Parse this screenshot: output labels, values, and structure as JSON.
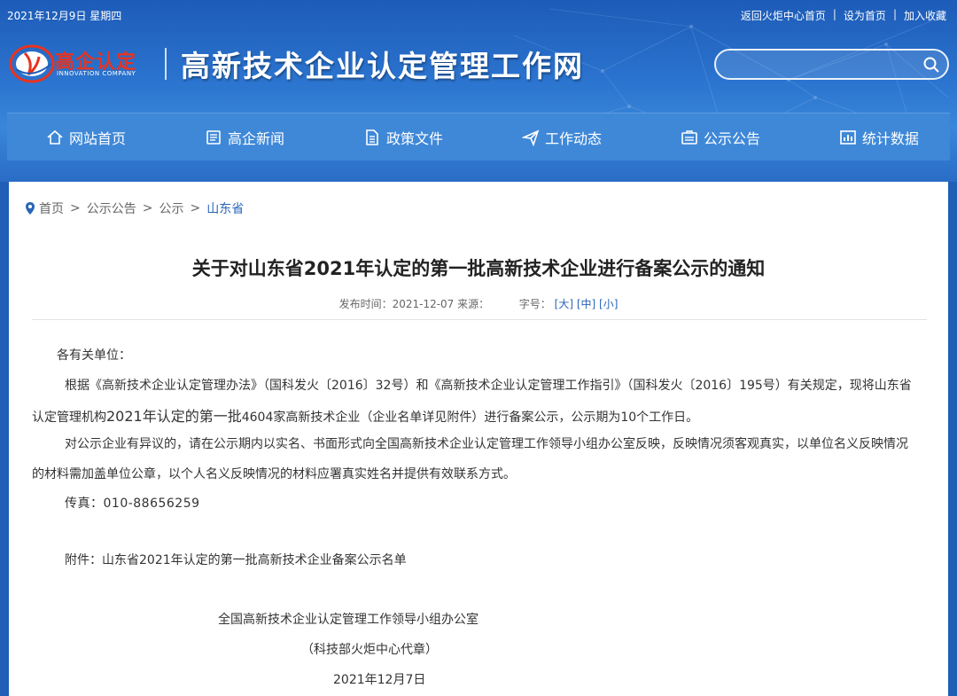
{
  "topbar": {
    "date": "2021年12月9日 星期四",
    "links": [
      "返回火炬中心首页",
      "设为首页",
      "加入收藏"
    ]
  },
  "logo": {
    "name": "高企认定",
    "sub": "INNOVATION COMPANY"
  },
  "site_title": "高新技术企业认定管理工作网",
  "search": {
    "value": "",
    "placeholder": ""
  },
  "nav": [
    {
      "label": "网站首页",
      "icon": "home-icon"
    },
    {
      "label": "高企新闻",
      "icon": "news-icon"
    },
    {
      "label": "政策文件",
      "icon": "document-icon"
    },
    {
      "label": "工作动态",
      "icon": "paper-plane-icon"
    },
    {
      "label": "公示公告",
      "icon": "notice-icon"
    },
    {
      "label": "统计数据",
      "icon": "chart-icon"
    }
  ],
  "breadcrumb": [
    "首页",
    "公示公告",
    "公示",
    "山东省"
  ],
  "article": {
    "title": "关于对山东省2021年认定的第一批高新技术企业进行备案公示的通知",
    "meta_time": "发布时间：2021-12-07 来源：",
    "font_label": "字号：",
    "font_sizes": [
      "[大]",
      "[中]",
      "[小]"
    ],
    "p1": "各有关单位：",
    "p2": "根据《高新技术企业认定管理办法》（国科发火〔2016〕32号）和《高新技术企业认定管理工作指引》（国科发火〔2016〕195号）有关规定，现将山东省",
    "p3a": "认定管理机构",
    "p3b": "2021年认定的第一批",
    "p3c": "4604家高新技术企业（企业名单详见附件）进行备案公示，公示期为10个工作日。",
    "p4": "对公示企业有异议的，请在公示期内以实名、书面形式向全国高新技术企业认定管理工作领导小组办公室反映，反映情况须客观真实，以单位名义反映情况",
    "p5": "的材料需加盖单位公章，以个人名义反映情况的材料应署真实姓名并提供有效联系方式。",
    "p6": "传真：010-88656259",
    "p7": "附件：山东省2021年认定的第一批高新技术企业备案公示名单",
    "p8": "全国高新技术企业认定管理工作领导小组办公室",
    "p9": "（科技部火炬中心代章）",
    "p10": "2021年12月7日"
  },
  "colors": {
    "header_blue": "#1f5fb5",
    "nav_blue": "#3f88d8",
    "logo_red": "#e8331f",
    "link_blue": "#2a66b8"
  }
}
